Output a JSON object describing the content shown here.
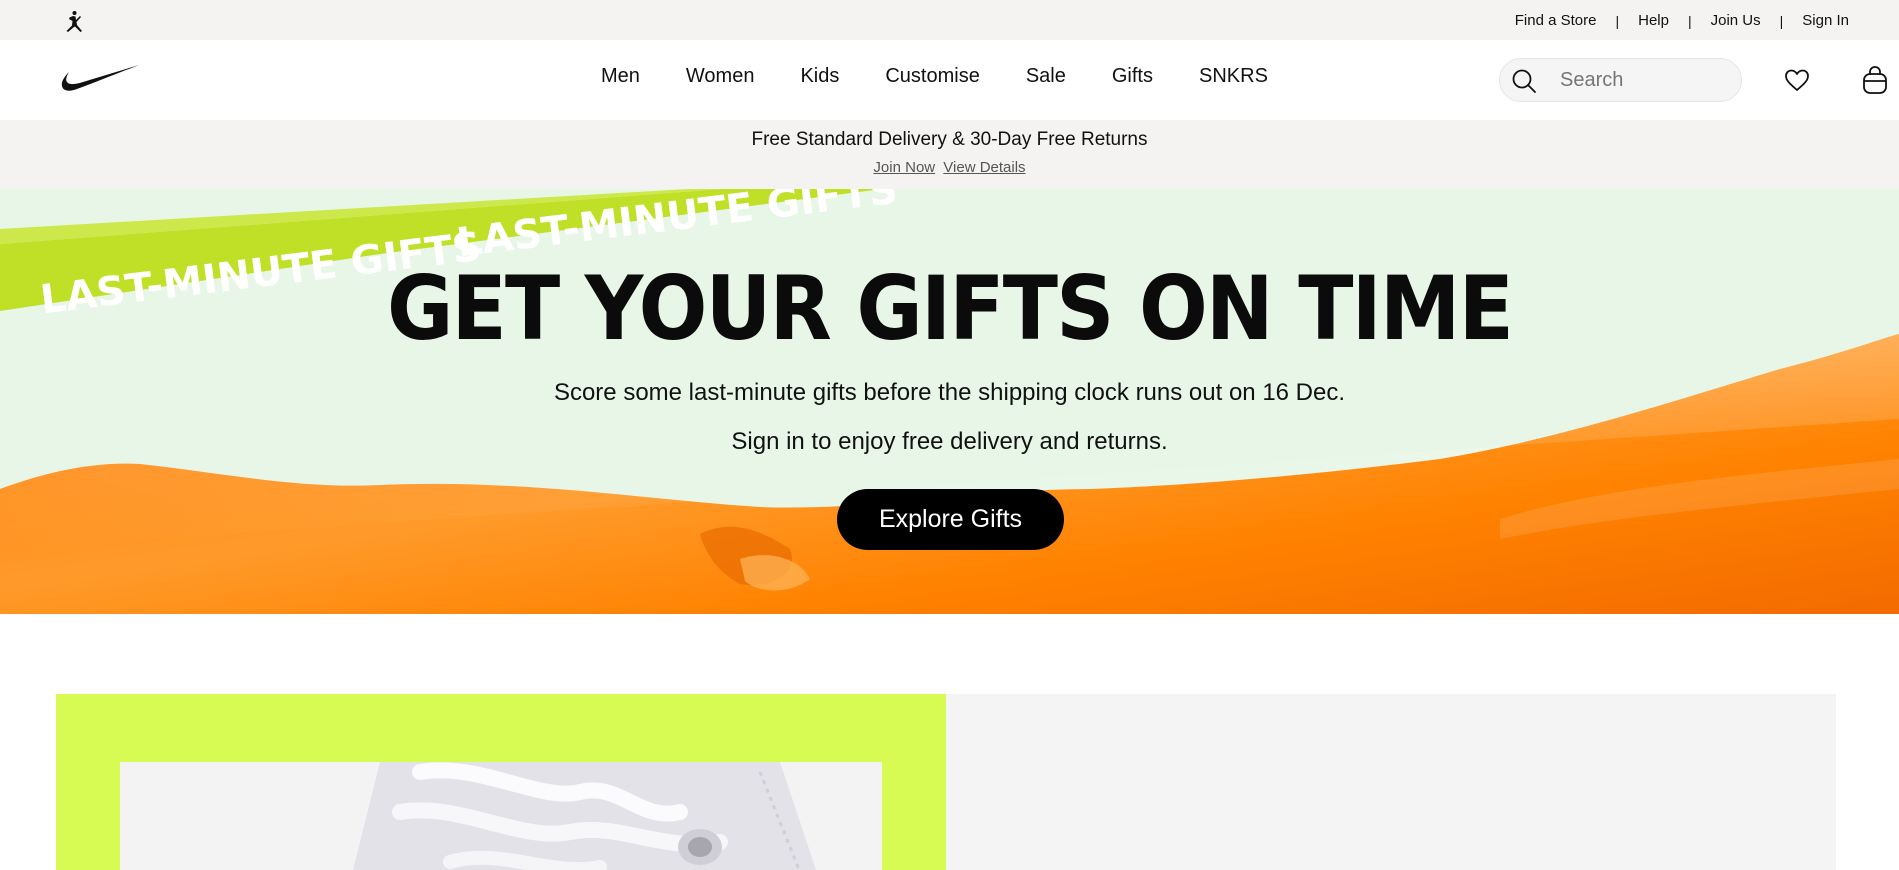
{
  "utility_bar": {
    "links": [
      "Find a Store",
      "Help",
      "Join Us",
      "Sign In"
    ],
    "separator": "|"
  },
  "nav": {
    "items": [
      "Men",
      "Women",
      "Kids",
      "Customise",
      "Sale",
      "Gifts",
      "SNKRS"
    ]
  },
  "search": {
    "placeholder": "Search"
  },
  "promo": {
    "title": "Free Standard Delivery & 30-Day Free Returns",
    "link_join": "Join Now",
    "link_details": "View Details"
  },
  "hero": {
    "ribbon_text": "LAST-MINUTE GIFTS",
    "headline": "GET YOUR GIFTS ON TIME",
    "subtitle_1": "Score some last-minute gifts before the shipping clock runs out on 16 Dec.",
    "subtitle_2": "Sign in to enjoy free delivery and returns.",
    "cta": "Explore Gifts"
  },
  "colors": {
    "hero_bg": "#e7f6e6",
    "ribbon": "#bfe027",
    "orange_wrap": "#ff8a0e",
    "feature_bg": "#d8fb53",
    "promo_bg": "#f5f2f2"
  },
  "icons": {
    "brand_logo": "swoosh-logo",
    "sub_brand_logo": "jordan-jumpman-logo",
    "search": "search-icon",
    "favourites": "heart-icon",
    "bag": "bag-icon"
  }
}
